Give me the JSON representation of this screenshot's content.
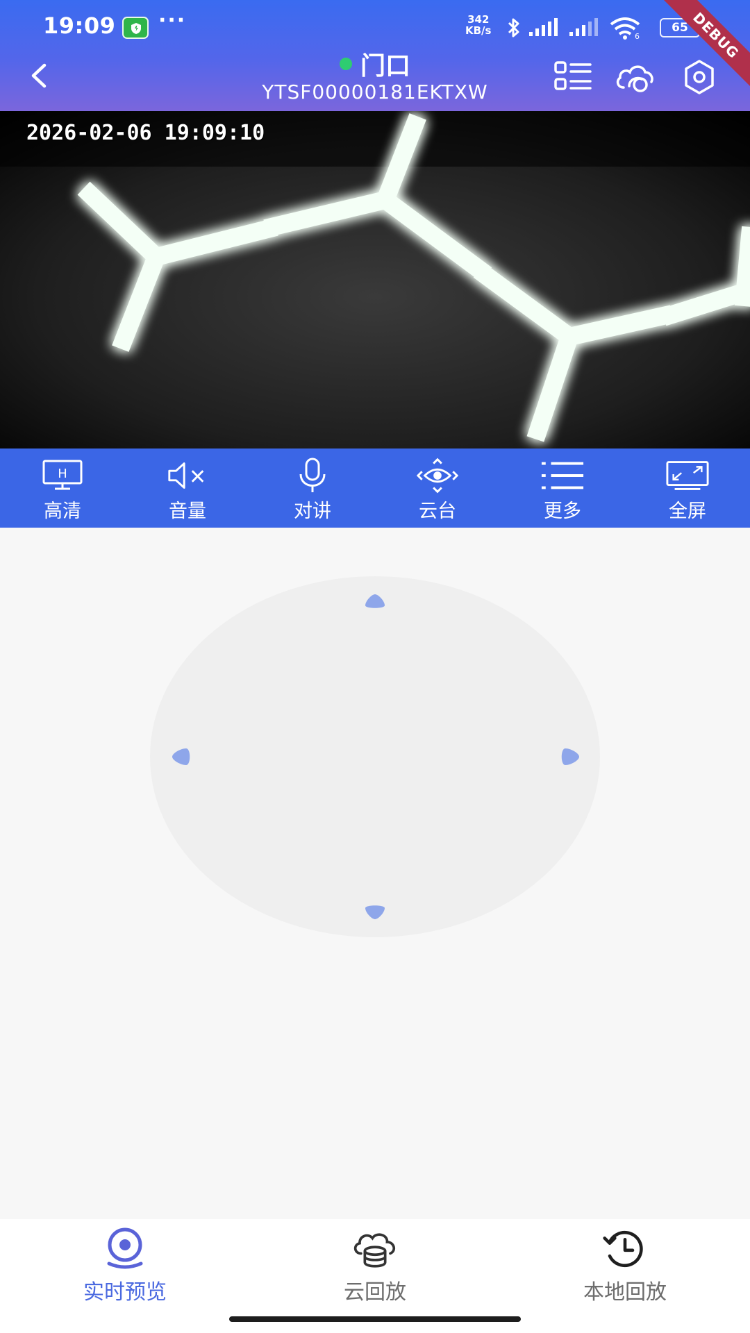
{
  "status_bar": {
    "time": "19:09",
    "more": "···",
    "net_speed_value": "342",
    "net_speed_unit": "KB/s",
    "wifi_label": "6",
    "battery": "65",
    "debug_label": "DEBUG"
  },
  "header": {
    "title": "门口",
    "device_id": "YTSF00000181EKTXW",
    "online_status_color": "#2ecc71",
    "icons": [
      "list-icon",
      "cloud-icon",
      "settings-icon"
    ]
  },
  "video": {
    "timestamp": "2026-02-06 19:09:10"
  },
  "toolbar": {
    "items": [
      {
        "label": "高清",
        "icon": "hd-monitor-icon"
      },
      {
        "label": "音量",
        "icon": "volume-muted-icon"
      },
      {
        "label": "对讲",
        "icon": "microphone-icon"
      },
      {
        "label": "云台",
        "icon": "ptz-icon"
      },
      {
        "label": "更多",
        "icon": "more-list-icon"
      },
      {
        "label": "全屏",
        "icon": "fullscreen-icon"
      }
    ]
  },
  "bottom_nav": {
    "items": [
      {
        "label": "实时预览",
        "icon": "live-camera-icon",
        "active": true
      },
      {
        "label": "云回放",
        "icon": "cloud-storage-icon",
        "active": false
      },
      {
        "label": "本地回放",
        "icon": "history-icon",
        "active": false
      }
    ]
  },
  "colors": {
    "accent": "#3b66e6",
    "ptz_arrow": "#8ea6ea",
    "active_nav": "#4a69e0"
  }
}
